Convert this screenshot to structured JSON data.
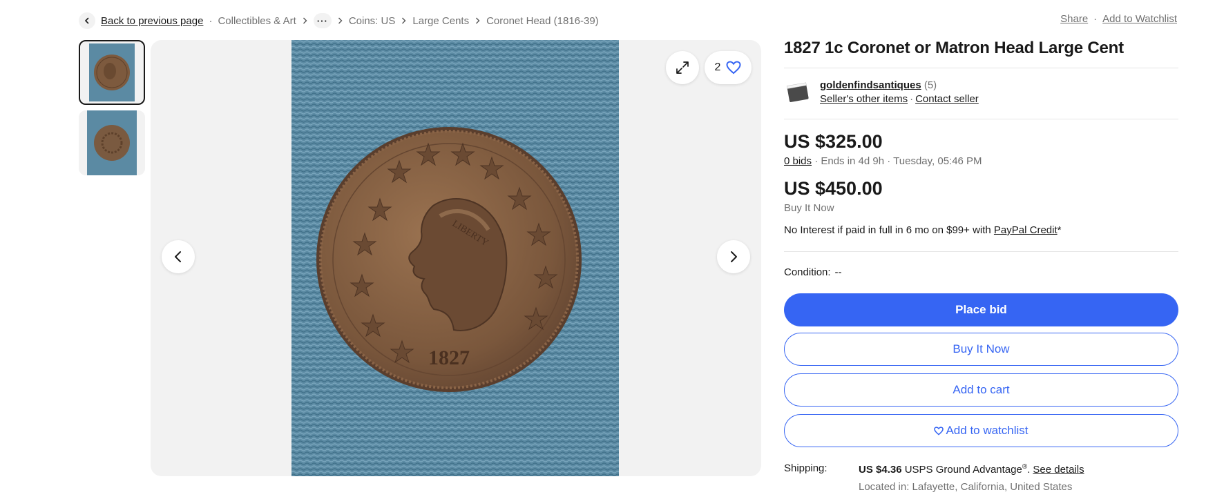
{
  "breadcrumb": {
    "back_label": "Back to previous page",
    "items": [
      "Collectibles & Art",
      "Coins: US",
      "Large Cents",
      "Coronet Head (1816-39)"
    ]
  },
  "top_actions": {
    "share": "Share",
    "separator": "·",
    "watchlist": "Add to Watchlist"
  },
  "gallery": {
    "watch_count": "2",
    "photo_year_text": "1827",
    "photo_liberty_text": "LIBERTY"
  },
  "listing": {
    "title": "1827 1c Coronet or Matron Head Large Cent",
    "seller": {
      "name": "goldenfindsantiques",
      "feedback": "(5)",
      "other_items": "Seller's other items",
      "separator": "·",
      "contact": "Contact seller"
    },
    "bid_price": "US $325.00",
    "bids": "0 bids",
    "ends": " · Ends in 4d 9h · Tuesday, 05:46 PM",
    "bin_price": "US $450.00",
    "bin_label": "Buy It Now",
    "credit_text": "No Interest if paid in full in 6 mo on $99+ with ",
    "credit_link": "PayPal Credit",
    "credit_suffix": "*",
    "condition_label": "Condition:",
    "condition_value": "--"
  },
  "buttons": {
    "place_bid": "Place bid",
    "buy_it_now": "Buy It Now",
    "add_to_cart": "Add to cart",
    "add_to_watchlist": "Add to watchlist"
  },
  "shipping": {
    "label": "Shipping:",
    "price": "US $4.36",
    "service": " USPS Ground Advantage",
    "reg_mark": "®",
    "dot": ".",
    "details_link": "See details",
    "location": "Located in: Lafayette, California, United States"
  },
  "colors": {
    "accent": "#3665f3",
    "text": "#191919",
    "muted": "#707070",
    "image_bg": "#f2f2f2",
    "carpet": "#5b8aa3",
    "coin": "#7d5a3e"
  }
}
